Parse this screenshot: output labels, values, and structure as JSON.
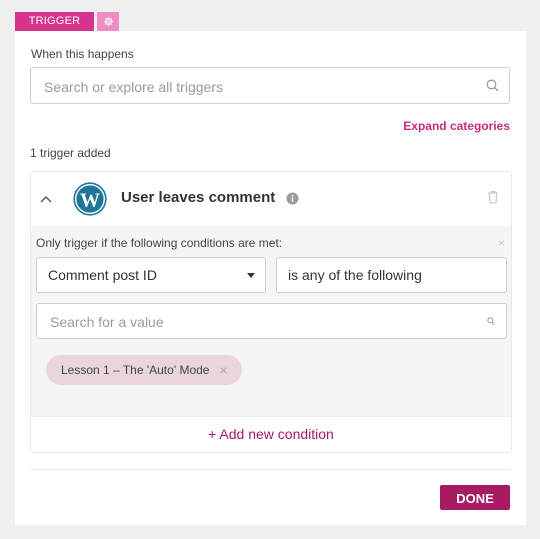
{
  "tabs": {
    "trigger_label": "TRIGGER",
    "settings_icon": "gear-icon"
  },
  "trigger_search": {
    "label": "When this happens",
    "placeholder": "Search or explore all triggers",
    "icon": "search-icon"
  },
  "expand_categories": "Expand categories",
  "trigger_count_text": "1 trigger added",
  "trigger": {
    "title": "User leaves comment",
    "logo": "wordpress-logo",
    "info_icon": "info-icon",
    "delete_icon": "trash-icon",
    "collapse_icon": "chevron-up-icon",
    "conditions": {
      "label": "Only trigger if the following conditions are met:",
      "close_symbol": "×",
      "field_selected": "Comment post ID",
      "operator": "is any of the following",
      "value_search_placeholder": "Search for a value",
      "selected_values": [
        {
          "label": "Lesson 1 – The 'Auto' Mode",
          "remove_symbol": "×"
        }
      ]
    },
    "add_condition_label": "+ Add new condition"
  },
  "done_label": "DONE",
  "colors": {
    "accent": "#d6338f",
    "accent_light": "#ee8dc2",
    "primary_dark": "#a71a64",
    "link": "#c72b7c",
    "chip_bg": "#ead5dd",
    "wordpress_blue": "#21759b",
    "page_bg": "#efefef"
  }
}
